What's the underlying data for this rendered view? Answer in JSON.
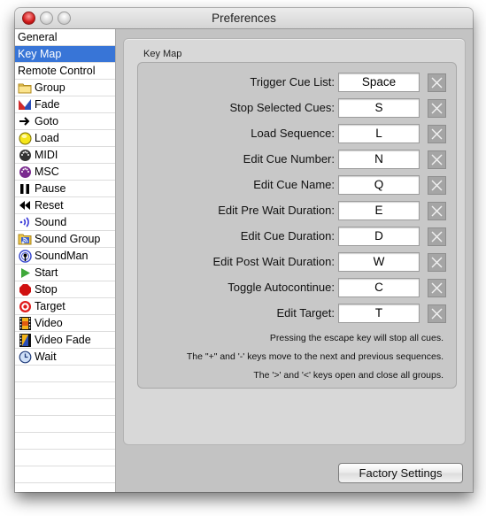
{
  "window": {
    "title": "Preferences"
  },
  "sidebar": {
    "items": [
      {
        "label": "General",
        "icon": "",
        "selected": false
      },
      {
        "label": "Key Map",
        "icon": "",
        "selected": true
      },
      {
        "label": "Remote Control",
        "icon": "",
        "selected": false
      },
      {
        "label": "Group",
        "icon": "folder-icon",
        "selected": false
      },
      {
        "label": "Fade",
        "icon": "fade-icon",
        "selected": false
      },
      {
        "label": "Goto",
        "icon": "arrow-right-icon",
        "selected": false
      },
      {
        "label": "Load",
        "icon": "load-icon",
        "selected": false
      },
      {
        "label": "MIDI",
        "icon": "midi-icon",
        "selected": false
      },
      {
        "label": "MSC",
        "icon": "msc-icon",
        "selected": false
      },
      {
        "label": "Pause",
        "icon": "pause-icon",
        "selected": false
      },
      {
        "label": "Reset",
        "icon": "rewind-icon",
        "selected": false
      },
      {
        "label": "Sound",
        "icon": "sound-icon",
        "selected": false
      },
      {
        "label": "Sound Group",
        "icon": "sound-group-icon",
        "selected": false
      },
      {
        "label": "SoundMan",
        "icon": "soundman-icon",
        "selected": false
      },
      {
        "label": "Start",
        "icon": "play-icon",
        "selected": false
      },
      {
        "label": "Stop",
        "icon": "stop-icon",
        "selected": false
      },
      {
        "label": "Target",
        "icon": "target-icon",
        "selected": false
      },
      {
        "label": "Video",
        "icon": "film-icon",
        "selected": false
      },
      {
        "label": "Video Fade",
        "icon": "video-fade-icon",
        "selected": false
      },
      {
        "label": "Wait",
        "icon": "clock-icon",
        "selected": false
      }
    ]
  },
  "keymap": {
    "group_title": "Key Map",
    "rows": [
      {
        "label": "Trigger Cue List:",
        "key": "Space"
      },
      {
        "label": "Stop Selected Cues:",
        "key": "S"
      },
      {
        "label": "Load Sequence:",
        "key": "L"
      },
      {
        "label": "Edit Cue Number:",
        "key": "N"
      },
      {
        "label": "Edit Cue Name:",
        "key": "Q"
      },
      {
        "label": "Edit Pre Wait Duration:",
        "key": "E"
      },
      {
        "label": "Edit Cue Duration:",
        "key": "D"
      },
      {
        "label": "Edit Post Wait Duration:",
        "key": "W"
      },
      {
        "label": "Toggle Autocontinue:",
        "key": "C"
      },
      {
        "label": "Edit Target:",
        "key": "T"
      }
    ],
    "notes": [
      "Pressing the escape key will stop all cues.",
      "The \"+\" and '-' keys move to the next and previous sequences.",
      "The '>' and '<' keys open and close all groups."
    ]
  },
  "footer": {
    "factory_settings_label": "Factory Settings"
  },
  "colors": {
    "selection": "#3875d7",
    "window_bg": "#c3c3c3"
  }
}
